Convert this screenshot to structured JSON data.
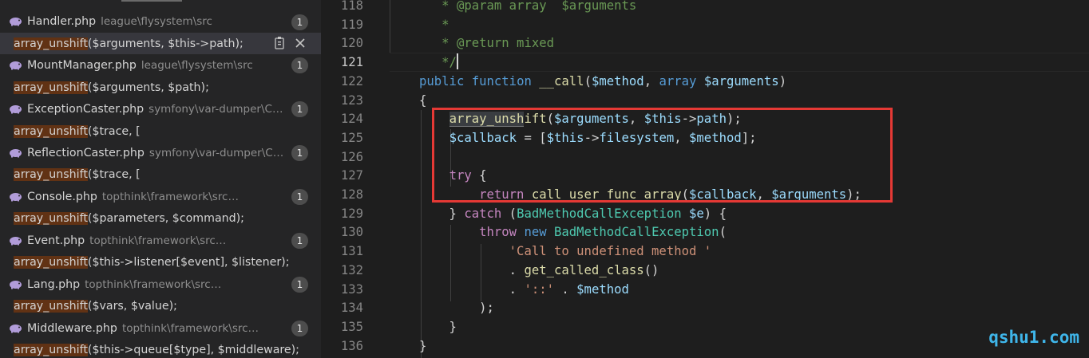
{
  "results": [
    {
      "file": "Handler.php",
      "path": "league\\flysystem\\src",
      "count": "1",
      "match": {
        "pre": "",
        "hl": "array_unshift",
        "post": "($arguments, $this->path);"
      },
      "actions": [
        "replace-icon",
        "close-icon"
      ]
    },
    {
      "file": "MountManager.php",
      "path": "league\\flysystem\\src",
      "count": "1",
      "match": {
        "pre": "",
        "hl": "array_unshift",
        "post": "($arguments, $path);"
      }
    },
    {
      "file": "ExceptionCaster.php",
      "path": "symfony\\var-dumper\\Cas...",
      "count": "1",
      "match": {
        "pre": "",
        "hl": "array_unshift",
        "post": "($trace, ["
      }
    },
    {
      "file": "ReflectionCaster.php",
      "path": "symfony\\var-dumper\\Ca...",
      "count": "1",
      "match": {
        "pre": "",
        "hl": "array_unshift",
        "post": "($trace, ["
      }
    },
    {
      "file": "Console.php",
      "path": "topthink\\framework\\src\\think",
      "count": "1",
      "match": {
        "pre": "",
        "hl": "array_unshift",
        "post": "($parameters, $command);"
      }
    },
    {
      "file": "Event.php",
      "path": "topthink\\framework\\src\\think",
      "count": "1",
      "match": {
        "pre": "",
        "hl": "array_unshift",
        "post": "($this->listener[$event], $listener);"
      }
    },
    {
      "file": "Lang.php",
      "path": "topthink\\framework\\src\\think",
      "count": "1",
      "match": {
        "pre": "",
        "hl": "array_unshift",
        "post": "($vars, $value);"
      }
    },
    {
      "file": "Middleware.php",
      "path": "topthink\\framework\\src\\think",
      "count": "1",
      "match": {
        "pre": "",
        "hl": "array_unshift",
        "post": "($this->queue[$type], $middleware);"
      }
    }
  ],
  "editor": {
    "current_line": "121",
    "lines": [
      {
        "n": "118",
        "tokens": [
          [
            "p",
            "   "
          ],
          [
            "c",
            "* @param array  $arguments"
          ]
        ]
      },
      {
        "n": "119",
        "tokens": [
          [
            "p",
            "   "
          ],
          [
            "c",
            "*"
          ]
        ]
      },
      {
        "n": "120",
        "tokens": [
          [
            "p",
            "   "
          ],
          [
            "c",
            "* @return mixed"
          ]
        ]
      },
      {
        "n": "121",
        "tokens": [
          [
            "p",
            "   "
          ],
          [
            "c",
            "*/"
          ]
        ],
        "cursor": true
      },
      {
        "n": "122",
        "tokens": [
          [
            "k",
            "public"
          ],
          [
            "p",
            " "
          ],
          [
            "k",
            "function"
          ],
          [
            "p",
            " "
          ],
          [
            "fn",
            "__call"
          ],
          [
            "p",
            "("
          ],
          [
            "v",
            "$method"
          ],
          [
            "p",
            ", "
          ],
          [
            "k",
            "array"
          ],
          [
            "p",
            " "
          ],
          [
            "v",
            "$arguments"
          ],
          [
            "p",
            ")"
          ]
        ]
      },
      {
        "n": "123",
        "tokens": [
          [
            "p",
            "{"
          ]
        ]
      },
      {
        "n": "124",
        "tokens": [
          [
            "p",
            "    "
          ],
          [
            "fnhl",
            "array_unsh"
          ],
          [
            "fn",
            "ift"
          ],
          [
            "p",
            "("
          ],
          [
            "v",
            "$arguments"
          ],
          [
            "p",
            ", "
          ],
          [
            "v",
            "$this"
          ],
          [
            "p",
            "->"
          ],
          [
            "v",
            "path"
          ],
          [
            "p",
            ");"
          ]
        ]
      },
      {
        "n": "125",
        "tokens": [
          [
            "p",
            "    "
          ],
          [
            "v",
            "$callback"
          ],
          [
            "p",
            " = ["
          ],
          [
            "v",
            "$this"
          ],
          [
            "p",
            "->"
          ],
          [
            "v",
            "filesystem"
          ],
          [
            "p",
            ", "
          ],
          [
            "v",
            "$method"
          ],
          [
            "p",
            "];"
          ]
        ]
      },
      {
        "n": "126",
        "tokens": []
      },
      {
        "n": "127",
        "tokens": [
          [
            "p",
            "    "
          ],
          [
            "ctl",
            "try"
          ],
          [
            "p",
            " {"
          ]
        ]
      },
      {
        "n": "128",
        "tokens": [
          [
            "p",
            "        "
          ],
          [
            "ctl",
            "return"
          ],
          [
            "p",
            " "
          ],
          [
            "fn",
            "call_user_func_array"
          ],
          [
            "p",
            "("
          ],
          [
            "v",
            "$callback"
          ],
          [
            "p",
            ", "
          ],
          [
            "v",
            "$arguments"
          ],
          [
            "p",
            ");"
          ]
        ]
      },
      {
        "n": "129",
        "tokens": [
          [
            "p",
            "    } "
          ],
          [
            "ctl",
            "catch"
          ],
          [
            "p",
            " ("
          ],
          [
            "cls",
            "BadMethodCallException"
          ],
          [
            "p",
            " "
          ],
          [
            "v",
            "$e"
          ],
          [
            "p",
            ") {"
          ]
        ]
      },
      {
        "n": "130",
        "tokens": [
          [
            "p",
            "        "
          ],
          [
            "ctl",
            "throw"
          ],
          [
            "p",
            " "
          ],
          [
            "k",
            "new"
          ],
          [
            "p",
            " "
          ],
          [
            "cls",
            "BadMethodCallException"
          ],
          [
            "p",
            "("
          ]
        ]
      },
      {
        "n": "131",
        "tokens": [
          [
            "p",
            "            "
          ],
          [
            "str",
            "'Call to undefined method '"
          ]
        ]
      },
      {
        "n": "132",
        "tokens": [
          [
            "p",
            "            . "
          ],
          [
            "fn",
            "get_called_class"
          ],
          [
            "p",
            "()"
          ]
        ]
      },
      {
        "n": "133",
        "tokens": [
          [
            "p",
            "            . "
          ],
          [
            "str",
            "'::'"
          ],
          [
            "p",
            " . "
          ],
          [
            "v",
            "$method"
          ]
        ]
      },
      {
        "n": "134",
        "tokens": [
          [
            "p",
            "        );"
          ]
        ]
      },
      {
        "n": "135",
        "tokens": [
          [
            "p",
            "    }"
          ]
        ]
      },
      {
        "n": "136",
        "tokens": [
          [
            "p",
            "}"
          ]
        ]
      }
    ]
  },
  "watermark": "qshu1.com",
  "colors": {
    "highlight_box": "#e53935",
    "match_highlight": "#613214",
    "watermark": "#3fb6ea"
  }
}
